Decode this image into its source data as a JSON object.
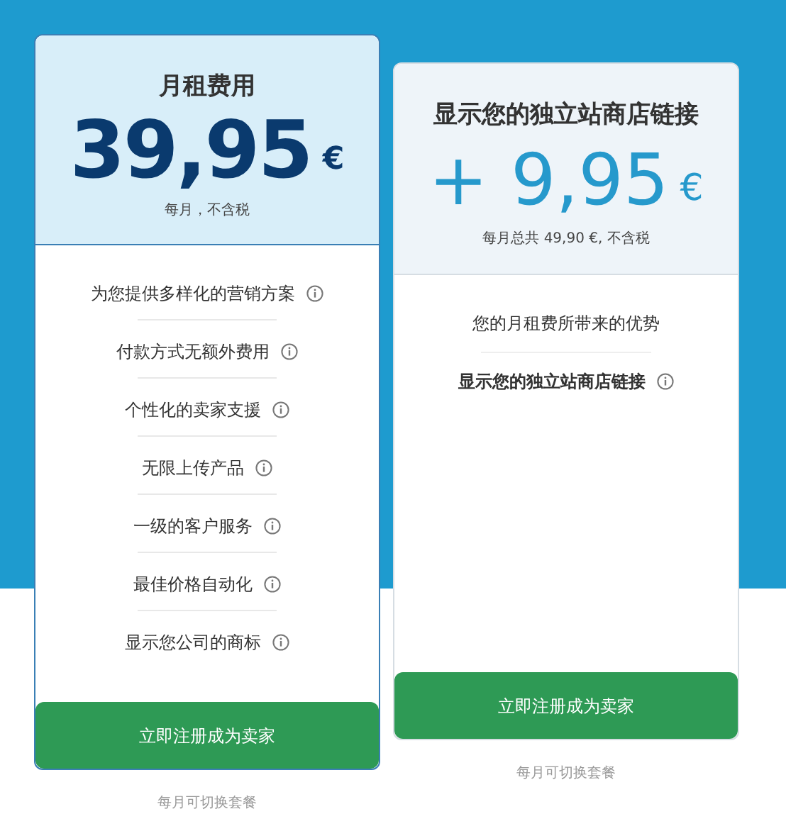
{
  "plans": [
    {
      "kind": "base",
      "title": "月租费用",
      "price": "39,95",
      "currency": "€",
      "price_note": "每月，不含税",
      "features": [
        "为您提供多样化的营销方案",
        "付款方式无额外费用",
        "个性化的卖家支援",
        "无限上传产品",
        "一级的客户服务",
        "最佳价格自动化",
        "显示您公司的商标"
      ],
      "button": "立即注册成为卖家",
      "footnote": "每月可切换套餐"
    },
    {
      "kind": "addon",
      "title": "显示您的独立站商店链接",
      "price": "+ 9,95",
      "currency": "€",
      "price_note": "每月总共 49,90 €, 不含税",
      "benefits_heading": "您的月租费所带来的优势",
      "features": [
        "显示您的独立站商店链接"
      ],
      "button": "立即注册成为卖家",
      "footnote": "每月可切换套餐"
    }
  ]
}
